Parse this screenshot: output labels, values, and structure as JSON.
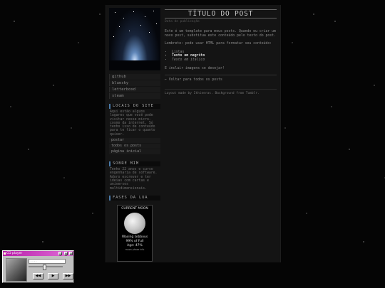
{
  "sidebar": {
    "nav": [
      "github",
      "bluesky",
      "letterboxd",
      "steam"
    ],
    "locals": {
      "title": "LOCAIS DO SITE",
      "text": "Aqui estão alguns lugares que você pode visitar nesse micro-cosmo da internet. Só tenho isso de conteúdo para te ficar o quanto quiser.",
      "links": [
        "postar",
        "todos os posts",
        "página inicial"
      ]
    },
    "about": {
      "title": "SOBRE MIM",
      "text": "Tenho 22 anos e curso engenharia de software. Adoro escrever e ter ideias com cartas e universos multidimensionais."
    },
    "moon": {
      "title": "FASES DA LUA",
      "caption": "CURRENT MOON",
      "phase": "Waxing Gibbous",
      "full": "99% of Full",
      "age": "Age: 47%",
      "credit": "moon phase info"
    }
  },
  "post": {
    "title": "TÍTULO DO POST",
    "date": "Data de publicação",
    "intro": "Este é um template para meus posts. Quando eu criar um novo post, substitua este conteúdo pelo texto do post.",
    "tip": "Lembrete: pode usar HTML para formatar seu conteúdo:",
    "list": [
      "Listas",
      "Texto em negrito",
      "Texto em itálico"
    ],
    "images": "E incluir imagens se desejar!",
    "back": "← Voltar para todos os posts",
    "footer": "Layout made by Ithineras. Background from Tumblr."
  },
  "player": {
    "title": "CD player",
    "track": "- - - -",
    "buttons": [
      "◀◀",
      "▶",
      "▶▶"
    ],
    "window_buttons": [
      "_",
      "□",
      "×"
    ]
  },
  "colors": {
    "accent": "#4a7aa8",
    "player_titlebar": "#b81da9"
  }
}
